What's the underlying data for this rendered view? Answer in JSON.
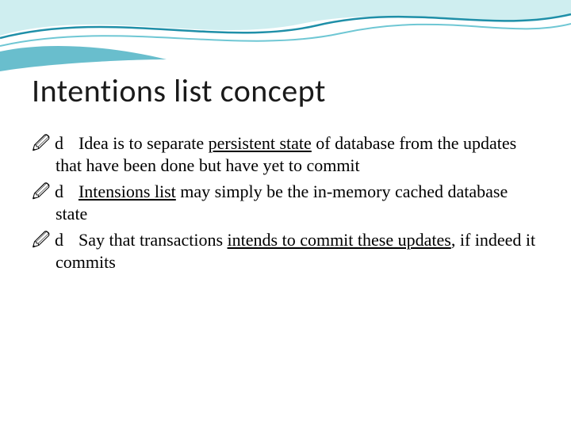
{
  "slide": {
    "title": "Intentions list concept",
    "bullets": [
      {
        "pre": "Idea is to separate ",
        "u1": "persistent state",
        "mid": " of database from the updates that have been done but have yet to commit",
        "u2": "",
        "post": ""
      },
      {
        "pre": "",
        "u1": "Intensions list",
        "mid": " may simply be the in-memory cached database state",
        "u2": "",
        "post": ""
      },
      {
        "pre": "Say that transactions ",
        "u1": "intends to commit these updates",
        "mid": ", if indeed it commits",
        "u2": "",
        "post": ""
      }
    ],
    "bullet_glyph": "d"
  },
  "theme": {
    "wave_color_light": "#bfe6ea",
    "wave_color_dark": "#1f8fa8",
    "wave_color_mid": "#5fbfd0"
  }
}
